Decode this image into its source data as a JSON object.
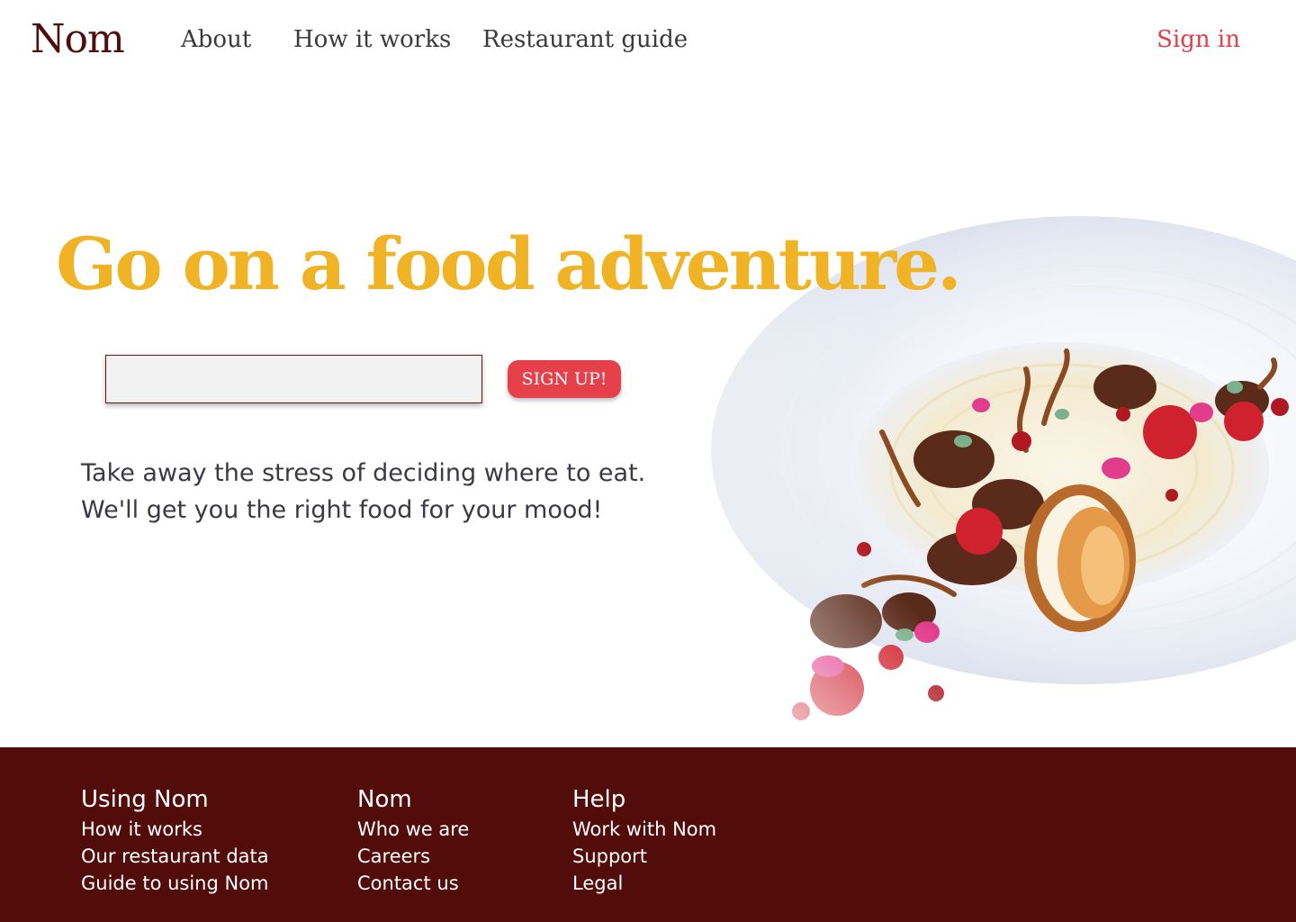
{
  "brand": {
    "name": "Nom"
  },
  "nav": {
    "items": [
      {
        "label": "About"
      },
      {
        "label": "How it works"
      },
      {
        "label": "Restaurant guide"
      }
    ],
    "sign_in": "Sign in"
  },
  "hero": {
    "headline": "Go on a food adventure.",
    "email_placeholder": "",
    "signup_label": "SIGN UP!",
    "tagline": [
      "Take away the stress of deciding where to eat.",
      "We'll get you the right food for your mood!"
    ],
    "image": "plated-dessert-photo"
  },
  "footer": {
    "columns": [
      {
        "heading": "Using Nom",
        "links": [
          "How it works",
          "Our restaurant data",
          "Guide to using Nom"
        ]
      },
      {
        "heading": "Nom",
        "links": [
          "Who we are",
          "Careers",
          "Contact us"
        ]
      },
      {
        "heading": "Help",
        "links": [
          "Work with Nom",
          "Support",
          "Legal"
        ]
      }
    ]
  },
  "colors": {
    "brand_dark": "#520d0b",
    "headline": "#efb325",
    "accent": "#e6404a"
  }
}
